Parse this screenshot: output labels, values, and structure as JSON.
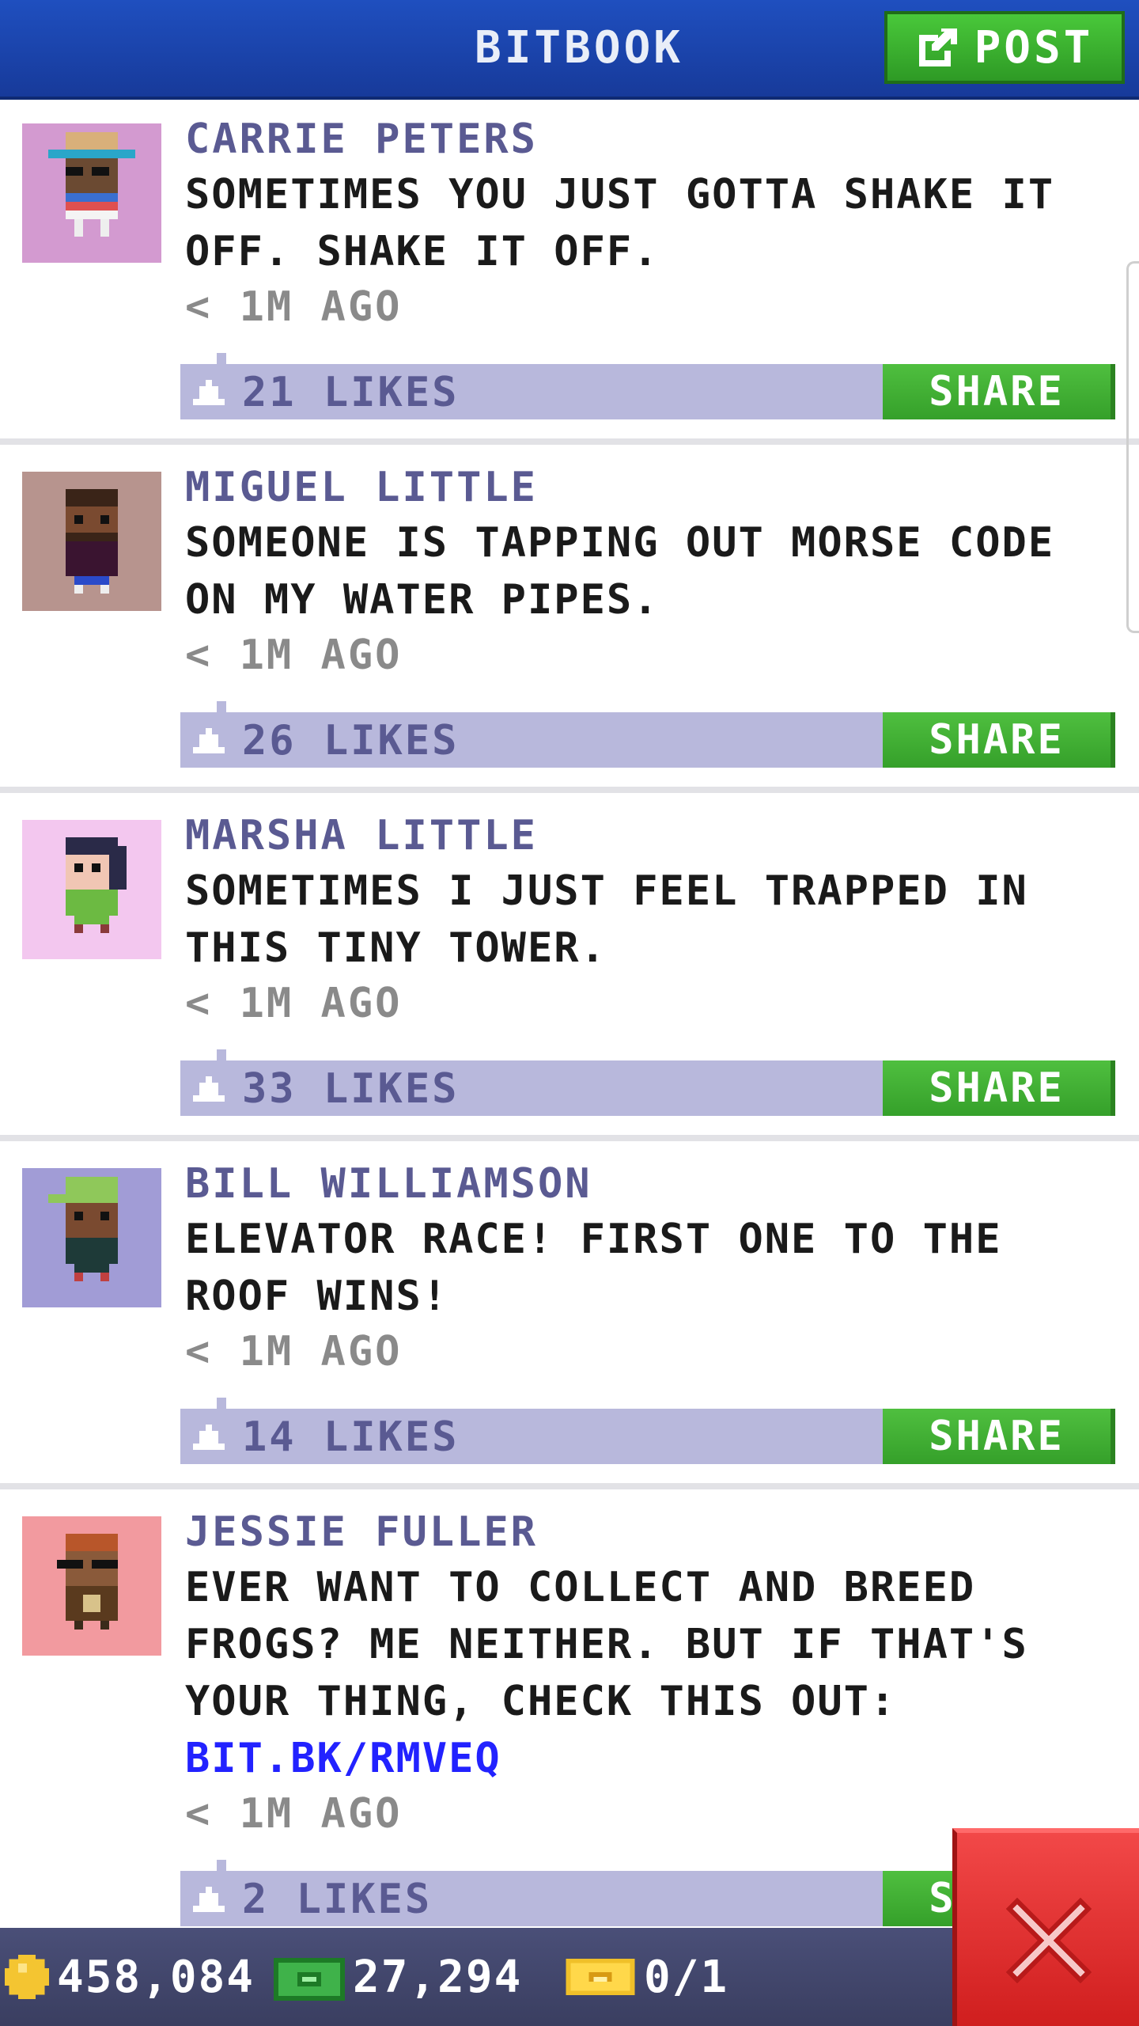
{
  "header": {
    "title": "BITBOOK",
    "post_label": "POST"
  },
  "posts": [
    {
      "author": "CARRIE PETERS",
      "message": "SOMETIMES YOU JUST GOTTA SHAKE IT OFF. SHAKE IT OFF.",
      "time": "< 1M AGO",
      "likes": "21 LIKES",
      "share": "SHARE",
      "avatar_color": "#d39ad0"
    },
    {
      "author": "MIGUEL LITTLE",
      "message": "SOMEONE IS TAPPING OUT MORSE CODE ON MY WATER PIPES.",
      "time": "< 1M AGO",
      "likes": "26 LIKES",
      "share": "SHARE",
      "avatar_color": "#b7948e"
    },
    {
      "author": "MARSHA LITTLE",
      "message": "SOMETIMES I JUST FEEL TRAPPED IN THIS TINY TOWER.",
      "time": "< 1M AGO",
      "likes": "33 LIKES",
      "share": "SHARE",
      "avatar_color": "#f3c7ef"
    },
    {
      "author": "BILL WILLIAMSON",
      "message": "ELEVATOR RACE! FIRST ONE TO THE ROOF WINS!",
      "time": "< 1M AGO",
      "likes": "14 LIKES",
      "share": "SHARE",
      "avatar_color": "#a19cd6"
    },
    {
      "author": "JESSIE FULLER",
      "message": "EVER WANT TO COLLECT AND BREED FROGS? ME NEITHER. BUT IF THAT'S YOUR THING, CHECK THIS OUT:",
      "link": "BIT.BK/RMVEQ",
      "time": "< 1M AGO",
      "likes": "2 LIKES",
      "share": "SHARE",
      "avatar_color": "#f29a9f"
    }
  ],
  "status_bar": {
    "coins": "458,084",
    "bux": "27,294",
    "tickets": "0/1"
  },
  "colors": {
    "header": "#1f4fbf",
    "accent_green": "#3aab2e",
    "like_bar": "#b8b8dc",
    "close_red": "#e02a2a"
  },
  "icons": [
    "edit-icon",
    "thumb-up-icon",
    "coin-icon",
    "cash-icon",
    "ticket-icon",
    "close-icon"
  ]
}
